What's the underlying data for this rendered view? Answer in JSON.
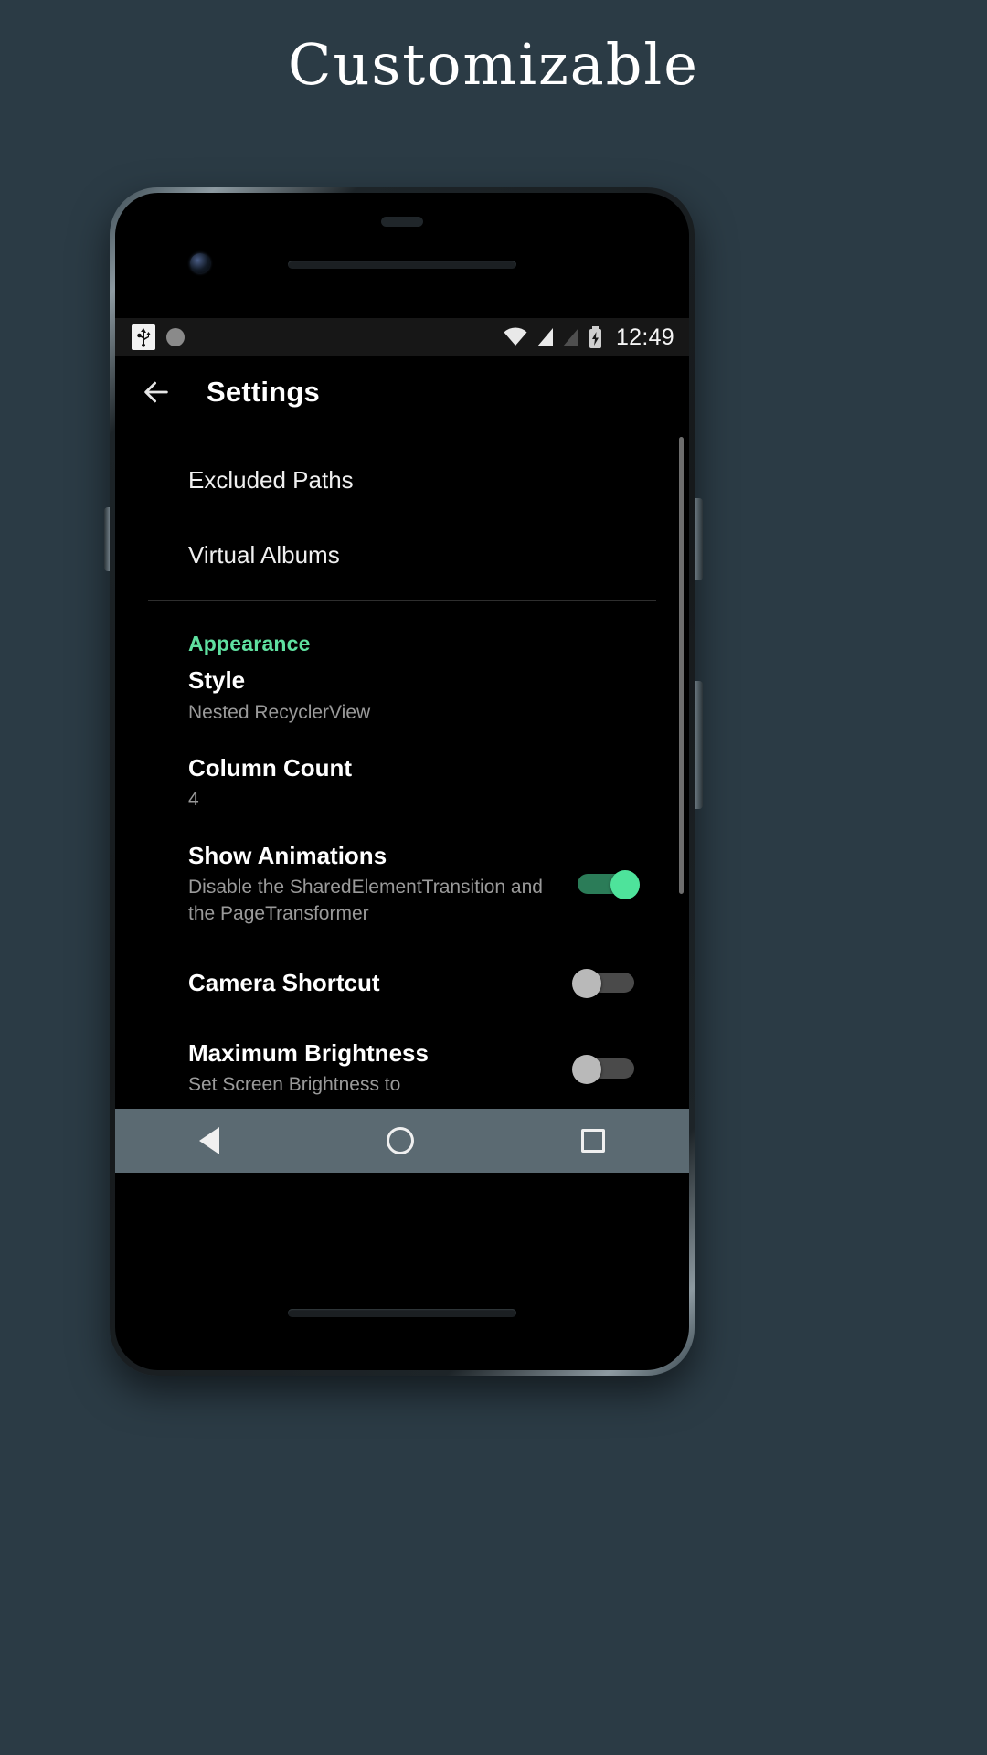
{
  "headline": "Customizable",
  "theme": {
    "background": "#2b3b45",
    "accent_green": "#5fe0a0",
    "toggle_on": "#4ee39b",
    "navbar": "#5b6a72"
  },
  "statusbar": {
    "time": "12:49",
    "icons": [
      "usb-icon",
      "circle-icon",
      "wifi-icon",
      "signal-icon",
      "signal-empty-icon",
      "battery-charging-icon"
    ]
  },
  "appbar": {
    "back_label": "back-arrow",
    "title": "Settings"
  },
  "settings": {
    "items_top": [
      {
        "title": "Excluded Paths"
      },
      {
        "title": "Virtual Albums"
      }
    ],
    "section_title": "Appearance",
    "items_appearance": [
      {
        "title": "Style",
        "subtitle": "Nested RecyclerView",
        "toggle": null
      },
      {
        "title": "Column Count",
        "subtitle": "4",
        "toggle": null
      },
      {
        "title": "Show Animations",
        "subtitle": "Disable the SharedElementTransition and the PageTransformer",
        "toggle": "on"
      },
      {
        "title": "Camera Shortcut",
        "subtitle": "",
        "toggle": "off"
      },
      {
        "title": "Maximum Brightness",
        "subtitle": "Set Screen Brightness to",
        "toggle": "off"
      }
    ]
  },
  "navbar": {
    "back": "nav-back-icon",
    "home": "nav-home-icon",
    "recents": "nav-recents-icon"
  }
}
